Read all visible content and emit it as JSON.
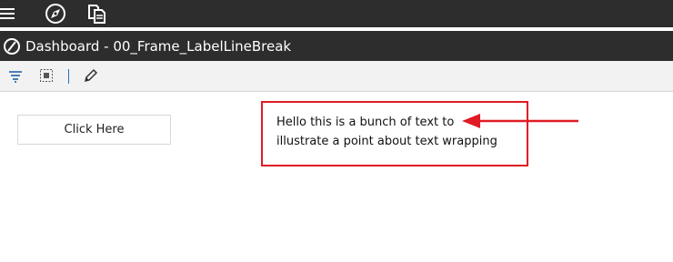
{
  "app": {
    "top_icons": [
      "hamburger-menu-icon",
      "compass-icon",
      "documents-icon"
    ],
    "title": "Dashboard - 00_Frame_LabelLineBreak",
    "colors": {
      "chrome_dark": "#2d2d2d",
      "toolbar_bg": "#f2f2f2",
      "annotation_red": "#e01b24",
      "separator_blue": "#2a6fb0"
    }
  },
  "toolbar": {
    "icons": [
      "filter-icon",
      "select-frame-icon",
      "edit-pencil-icon"
    ]
  },
  "canvas": {
    "button_label": "Click Here",
    "label_line1": "Hello this is a bunch of text to",
    "label_line2": "illustrate a point about text wrapping"
  }
}
